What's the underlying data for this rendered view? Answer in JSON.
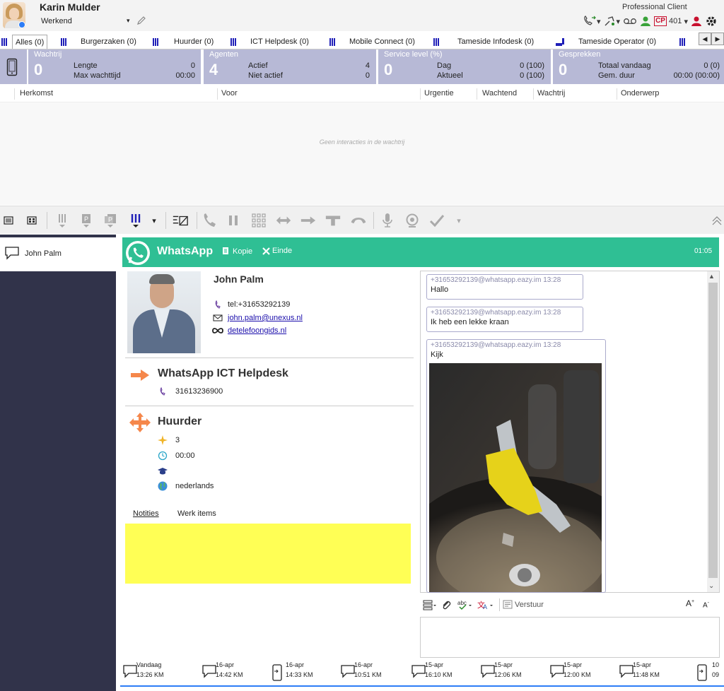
{
  "header": {
    "agent_name": "Karin Mulder",
    "agent_status": "Werkend",
    "client_label": "Professional Client",
    "extension": "401"
  },
  "queue_tabs": [
    {
      "label": "Alles (0)"
    },
    {
      "label": "Burgerzaken (0)"
    },
    {
      "label": "Huurder (0)"
    },
    {
      "label": "ICT Helpdesk (0)"
    },
    {
      "label": "Mobile Connect (0)"
    },
    {
      "label": "Tameside Infodesk (0)"
    },
    {
      "label": "Tameside Operator (0)"
    }
  ],
  "stats": {
    "wachtrij": {
      "title": "Wachtrij",
      "big": "0",
      "l1": "Lengte",
      "v1": "0",
      "l2": "Max wachttijd",
      "v2": "00:00"
    },
    "agenten": {
      "title": "Agenten",
      "big": "4",
      "l1": "Actief",
      "v1": "4",
      "l2": "Niet actief",
      "v2": "0"
    },
    "service": {
      "title": "Service level (%)",
      "big": "0",
      "l1": "Dag",
      "v1": "0 (100)",
      "l2": "Aktueel",
      "v2": "0 (100)"
    },
    "gesprekken": {
      "title": "Gesprekken",
      "big": "0",
      "l1": "Totaal vandaag",
      "v1": "0 (0)",
      "l2": "Gem. duur",
      "v2": "00:00 (00:00)"
    }
  },
  "queue_columns": [
    "Herkomst",
    "Voor",
    "Urgentie",
    "Wachtend",
    "Wachtrij",
    "Onderwerp"
  ],
  "queue_empty": "Geen interacties in de wachtrij",
  "interaction_list": {
    "name": "John Palm"
  },
  "whatsapp": {
    "title": "WhatsApp",
    "copy": "Kopie",
    "end": "Einde",
    "timer": "01:05"
  },
  "contact": {
    "name": "John Palm",
    "tel": "tel:+31653292139",
    "email": "john.palm@unexus.nl",
    "link": "detelefoongids.nl"
  },
  "channel": {
    "name": "WhatsApp ICT Helpdesk",
    "number": "31613236900"
  },
  "queue_info": {
    "name": "Huurder",
    "priority": "3",
    "time": "00:00",
    "language": "nederlands"
  },
  "tabs": {
    "notes": "Notities",
    "work": "Werk items"
  },
  "messages": [
    {
      "meta": "+31653292139@whatsapp.eazy.im 13:28",
      "text": "Hallo"
    },
    {
      "meta": "+31653292139@whatsapp.eazy.im 13:28",
      "text": "Ik heb een lekke kraan"
    },
    {
      "meta": "+31653292139@whatsapp.eazy.im 13:28",
      "text": "Kijk"
    }
  ],
  "compose": {
    "send": "Verstuur"
  },
  "timeline": [
    {
      "d1": "Vandaag",
      "d2": "13:26   KM",
      "icon": "chat-icon"
    },
    {
      "d1": "16-apr",
      "d2": "14:42   KM",
      "icon": "chat-icon"
    },
    {
      "d1": "16-apr",
      "d2": "14:33   KM",
      "icon": "phone-in-icon"
    },
    {
      "d1": "16-apr",
      "d2": "10:51   KM",
      "icon": "chat-icon"
    },
    {
      "d1": "15-apr",
      "d2": "16:10   KM",
      "icon": "chat-icon"
    },
    {
      "d1": "15-apr",
      "d2": "12:06   KM",
      "icon": "chat-icon"
    },
    {
      "d1": "15-apr",
      "d2": "12:00   KM",
      "icon": "chat-icon"
    },
    {
      "d1": "15-apr",
      "d2": "11:48   KM",
      "icon": "chat-icon"
    },
    {
      "d1": "10",
      "d2": "09",
      "icon": "phone-in-icon"
    }
  ],
  "colors": {
    "whatsapp": "#2fbf94",
    "stat_bg": "#b7b9d6",
    "sidebar": "#31334a",
    "notes": "#ffff55",
    "accent": "#2d7df6"
  }
}
